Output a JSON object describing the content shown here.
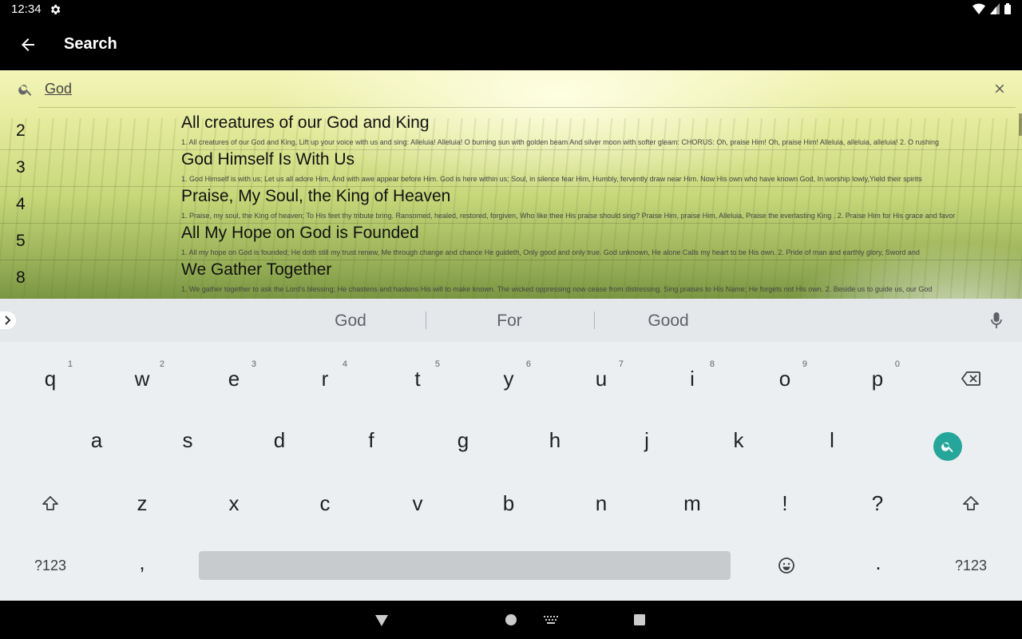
{
  "status_bar": {
    "time": "12:34"
  },
  "app_bar": {
    "title": "Search"
  },
  "search": {
    "query": "God"
  },
  "results": [
    {
      "number": "2",
      "title": "All creatures of our God and King",
      "excerpt": "1. All creatures of our God and King, Lift up your voice with us and sing: Alleluia! Alleluia! O burning sun with golden beam And silver moon with softer gleam: CHORUS: Oh, praise Him! Oh, praise Him! Alleluia, alleluia, alleluia! 2. O rushing"
    },
    {
      "number": "3",
      "title": "God Himself Is With Us",
      "excerpt": "1. God Himself is with us; Let us all adore Him, And with awe appear before Him. God is here within us; Soul, in silence fear Him, Humbly, fervently draw near Him. Now His own who have known God, In worship lowly,Yield their spirits"
    },
    {
      "number": "4",
      "title": "Praise, My Soul, the King of Heaven",
      "excerpt": "1. Praise, my soul, the King of heaven; To His feet thy tribute bring. Ransomed, healed, restored, forgiven, Who like thee His praise should sing? Praise Him, praise Him, Alleluia, Praise the everlasting King . 2. Praise Him for His grace and favor"
    },
    {
      "number": "5",
      "title": "All My Hope on God is Founded",
      "excerpt": "1. All my hope on God is founded; He doth still my trust renew, Me through change and chance He guideth, Only good and only true. God unknown, He alone Calls my heart to be His own. 2. Pride of man and earthly glory, Sword and"
    },
    {
      "number": "8",
      "title": "We Gather Together",
      "excerpt": "1. We gather together to ask the Lord's blessing; He chastens and hastens His will to make known. The wicked oppressing now cease from distressing. Sing praises to His Name; He forgets not His own. 2. Beside us to guide us, our God"
    }
  ],
  "keyboard": {
    "suggestions": [
      "God",
      "For",
      "Good"
    ],
    "row1": [
      {
        "key": "q",
        "hint": "1"
      },
      {
        "key": "w",
        "hint": "2"
      },
      {
        "key": "e",
        "hint": "3"
      },
      {
        "key": "r",
        "hint": "4"
      },
      {
        "key": "t",
        "hint": "5"
      },
      {
        "key": "y",
        "hint": "6"
      },
      {
        "key": "u",
        "hint": "7"
      },
      {
        "key": "i",
        "hint": "8"
      },
      {
        "key": "o",
        "hint": "9"
      },
      {
        "key": "p",
        "hint": "0"
      }
    ],
    "row2": [
      "a",
      "s",
      "d",
      "f",
      "g",
      "h",
      "j",
      "k",
      "l"
    ],
    "row3": [
      "z",
      "x",
      "c",
      "v",
      "b",
      "n",
      "m",
      "!",
      "?"
    ],
    "symbols_label": "?123",
    "comma": ",",
    "period": ".",
    "accent_color": "#26a69a"
  }
}
